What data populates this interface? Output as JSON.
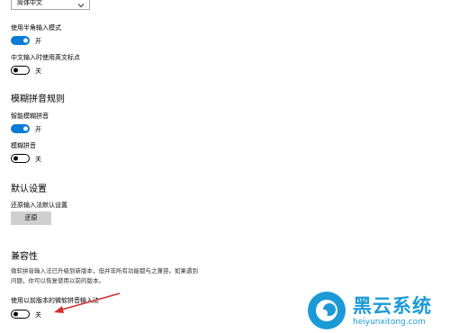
{
  "settings": {
    "dropdown_value": "简体中文",
    "halfwidth": {
      "label": "使用半角输入模式",
      "state": "开",
      "on": true
    },
    "chinese_punct": {
      "label": "中文输入时使用英文标点",
      "state": "关",
      "on": false
    },
    "fuzzy_section": "模糊拼音规则",
    "smart_fuzzy": {
      "label": "智能模糊拼音",
      "state": "开",
      "on": true
    },
    "fuzzy": {
      "label": "模糊拼音",
      "state": "关",
      "on": false
    },
    "default_section": "默认设置",
    "restore_label": "还原输入法默认设置",
    "restore_button": "还原",
    "compat_section": "兼容性",
    "compat_desc_line1": "微软拼音输入法已升级到新版本，但并非所有功能都与之兼容。如果遇到",
    "compat_desc_line2": "问题，你可以恢复使用以前的版本。",
    "old_version": {
      "label": "使用以前版本的微软拼音输入法",
      "state": "关",
      "on": false
    }
  },
  "watermark": {
    "brand": "黑云系统",
    "url": "heiyunxitong.com",
    "accent": "#1c9ad6"
  },
  "annotation": {
    "arrow_color": "#d0312d"
  }
}
